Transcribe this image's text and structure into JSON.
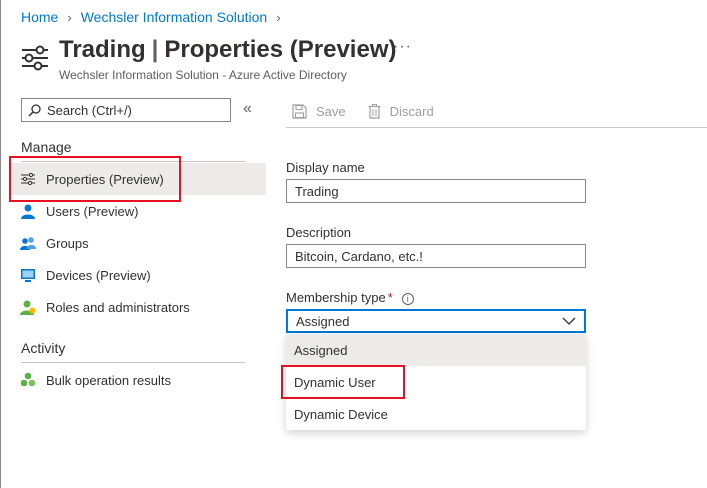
{
  "breadcrumb": {
    "items": [
      "Home",
      "Wechsler Information Solution"
    ]
  },
  "header": {
    "title": "Trading",
    "title_section": "Properties (Preview)",
    "subtitle": "Wechsler Information Solution - Azure Active Directory",
    "more_label": "···"
  },
  "sidebar": {
    "search_placeholder": "Search (Ctrl+/)",
    "collapse_label": "«",
    "manage_heading": "Manage",
    "manage_items": [
      {
        "label": "Properties (Preview)",
        "icon": "properties-icon"
      },
      {
        "label": "Users (Preview)",
        "icon": "user-icon"
      },
      {
        "label": "Groups",
        "icon": "groups-icon"
      },
      {
        "label": "Devices (Preview)",
        "icon": "device-icon"
      },
      {
        "label": "Roles and administrators",
        "icon": "roles-icon"
      }
    ],
    "activity_heading": "Activity",
    "activity_items": [
      {
        "label": "Bulk operation results",
        "icon": "bulk-results-icon"
      }
    ]
  },
  "toolbar": {
    "save_label": "Save",
    "discard_label": "Discard"
  },
  "form": {
    "display_name_label": "Display name",
    "display_name_value": "Trading",
    "description_label": "Description",
    "description_value": "Bitcoin, Cardano, etc.!",
    "membership_type_label": "Membership type",
    "required_marker": "*",
    "info_glyph": "i",
    "membership_type_value": "Assigned",
    "membership_options": [
      "Assigned",
      "Dynamic User",
      "Dynamic Device"
    ]
  },
  "colors": {
    "link": "#0078d4",
    "highlight": "#e81123",
    "selected_bg": "#edebe9",
    "focus_border": "#0078d4",
    "required": "#a4262c"
  }
}
